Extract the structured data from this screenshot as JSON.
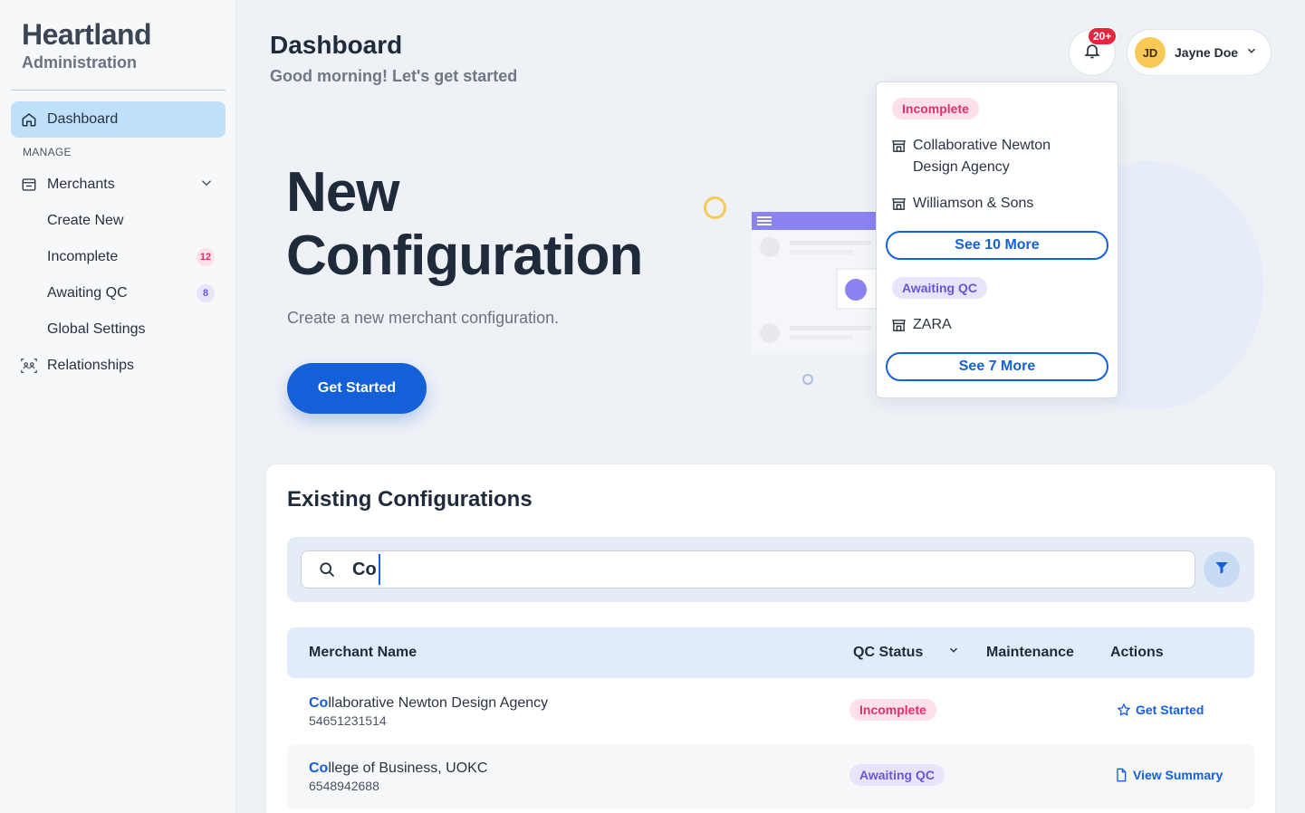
{
  "brand": {
    "name": "Heartland",
    "subtitle": "Administration"
  },
  "sidebar": {
    "dashboard": "Dashboard",
    "section_label": "MANAGE",
    "merchants": "Merchants",
    "create_new": "Create New",
    "incomplete": "Incomplete",
    "incomplete_count": "12",
    "awaiting_qc": "Awaiting QC",
    "awaiting_qc_count": "8",
    "global_settings": "Global Settings",
    "relationships": "Relationships"
  },
  "header": {
    "title": "Dashboard",
    "greeting": "Good morning! Let's get started",
    "notifications_badge": "20+",
    "user_initials": "JD",
    "user_name": "Jayne Doe"
  },
  "hero": {
    "title_line1": "New",
    "title_line2": "Configuration",
    "subtitle": "Create a new merchant configuration.",
    "cta": "Get Started"
  },
  "notifications_popup": {
    "incomplete_label": "Incomplete",
    "incomplete_items": [
      "Collaborative Newton",
      "Design Agency",
      "Williamson & Sons"
    ],
    "incomplete_more": "See 10 More",
    "awaiting_label": "Awaiting QC",
    "awaiting_items": [
      "ZARA"
    ],
    "awaiting_more": "See 7 More"
  },
  "existing": {
    "title": "Existing Configurations",
    "search_value": "Co",
    "columns": {
      "merchant": "Merchant Name",
      "qc_status": "QC Status",
      "maintenance": "Maintenance",
      "actions": "Actions"
    },
    "rows": [
      {
        "name_match": "Co",
        "name_rest": "llaborative Newton Design Agency",
        "id": "54651231514",
        "status": "Incomplete",
        "action": "Get Started"
      },
      {
        "name_match": "Co",
        "name_rest": "llege of Business, UOKC",
        "id": "6548942688",
        "status": "Awaiting QC",
        "action": "View Summary"
      }
    ]
  },
  "colors": {
    "primary": "#1460d9",
    "incomplete": "#e0306a",
    "awaiting_qc": "#6a55d8",
    "active_nav": "#bfe0fb"
  }
}
